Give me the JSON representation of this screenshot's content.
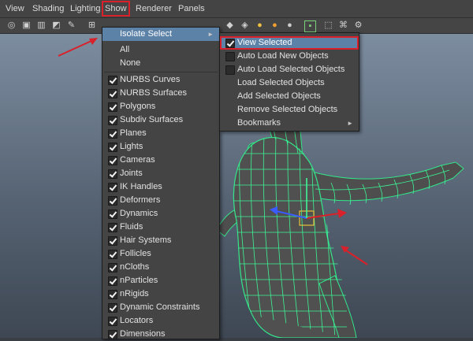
{
  "menubar": {
    "items": [
      "View",
      "Shading",
      "Lighting",
      "Show",
      "Renderer",
      "Panels"
    ]
  },
  "toolbar": {
    "icons": [
      "camera-icon",
      "camera-attrs-icon",
      "bookmark-icon",
      "image-plane-icon",
      "2d-pan-zoom-icon",
      "grease-pencil-icon",
      "grid-icon",
      "shading-icon",
      "lights-icon",
      "isolate-icon",
      "xray-icon"
    ]
  },
  "show_menu": {
    "isolate_label": "Isolate Select",
    "all_label": "All",
    "none_label": "None",
    "items": [
      {
        "label": "NURBS Curves",
        "checked": true
      },
      {
        "label": "NURBS Surfaces",
        "checked": true
      },
      {
        "label": "Polygons",
        "checked": true
      },
      {
        "label": "Subdiv Surfaces",
        "checked": true
      },
      {
        "label": "Planes",
        "checked": true
      },
      {
        "label": "Lights",
        "checked": true
      },
      {
        "label": "Cameras",
        "checked": true
      },
      {
        "label": "Joints",
        "checked": true
      },
      {
        "label": "IK Handles",
        "checked": true
      },
      {
        "label": "Deformers",
        "checked": true
      },
      {
        "label": "Dynamics",
        "checked": true
      },
      {
        "label": "Fluids",
        "checked": true
      },
      {
        "label": "Hair Systems",
        "checked": true
      },
      {
        "label": "Follicles",
        "checked": true
      },
      {
        "label": "nCloths",
        "checked": true
      },
      {
        "label": "nParticles",
        "checked": true
      },
      {
        "label": "nRigids",
        "checked": true
      },
      {
        "label": "Dynamic Constraints",
        "checked": true
      },
      {
        "label": "Locators",
        "checked": true
      },
      {
        "label": "Dimensions",
        "checked": true
      }
    ]
  },
  "isolate_submenu": {
    "items": [
      {
        "label": "View Selected",
        "checked": true
      },
      {
        "label": "Auto Load New Objects",
        "checked": false
      },
      {
        "label": "Auto Load Selected Objects",
        "checked": false
      },
      {
        "label": "Load Selected Objects"
      },
      {
        "label": "Add Selected Objects"
      },
      {
        "label": "Remove Selected Objects"
      },
      {
        "label": "Bookmarks",
        "submenu": true
      }
    ]
  },
  "colors": {
    "highlight": "#5d82a8",
    "annotation_red": "#d8212a",
    "wireframe": "#3cff9a"
  }
}
